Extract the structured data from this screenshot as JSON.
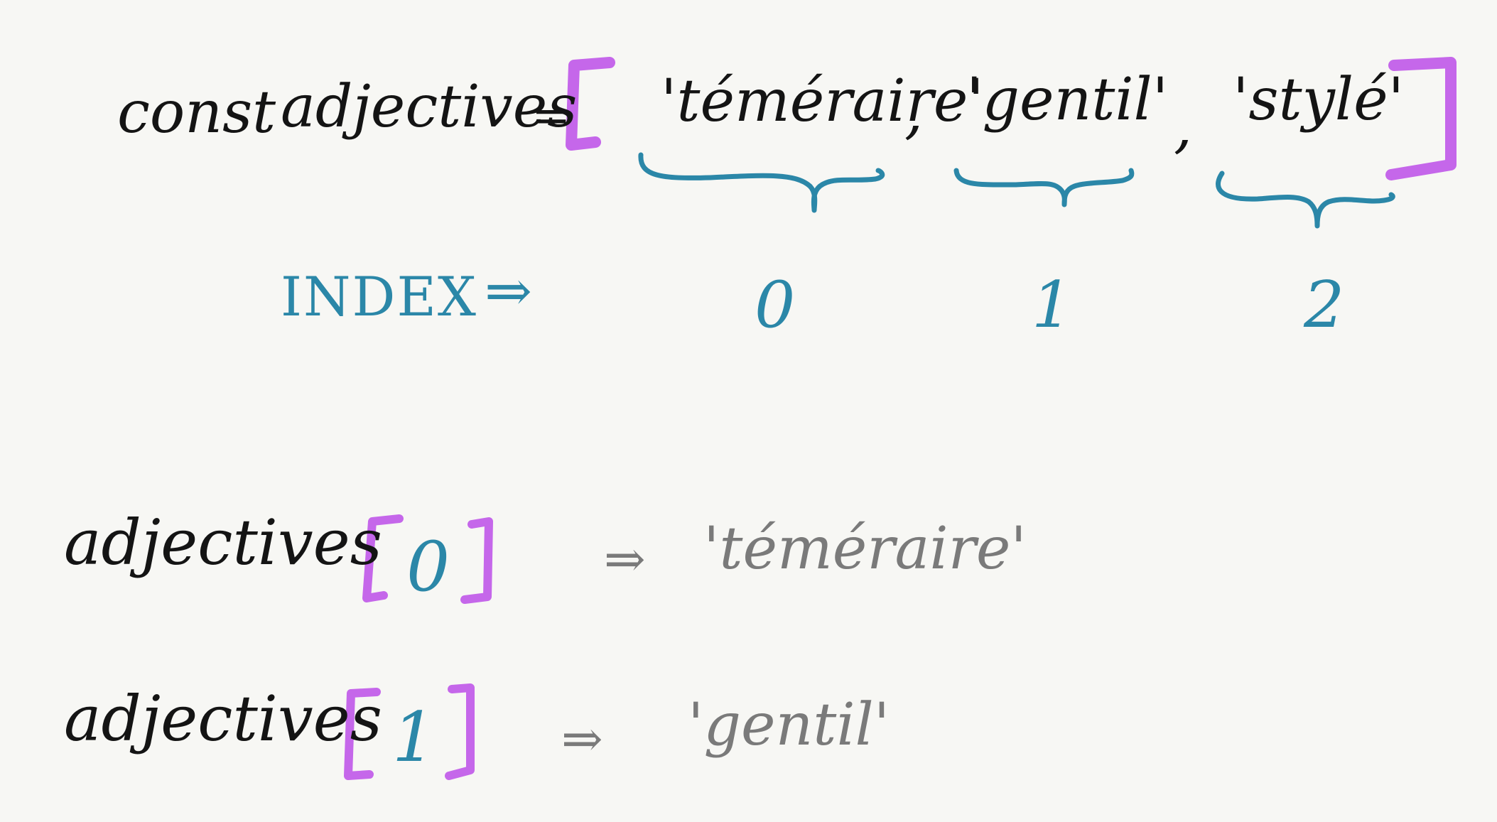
{
  "declaration": {
    "keyword": "const",
    "name": "adjectives",
    "equals": "=",
    "elements": [
      "'téméraire'",
      "'gentil'",
      "'stylé'"
    ],
    "separator": ","
  },
  "index_row": {
    "label": "INDEX",
    "arrow": "⇒",
    "indices": [
      "0",
      "1",
      "2"
    ]
  },
  "access_examples": [
    {
      "name": "adjectives",
      "index": "0",
      "arrow": "⇒",
      "result": "'téméraire'"
    },
    {
      "name": "adjectives",
      "index": "1",
      "arrow": "⇒",
      "result": "'gentil'"
    }
  ],
  "colors": {
    "background": "#f7f7f4",
    "ink": "#141414",
    "bracket": "#c567ea",
    "annotation": "#2b87a8",
    "result": "#7a7a7a"
  }
}
